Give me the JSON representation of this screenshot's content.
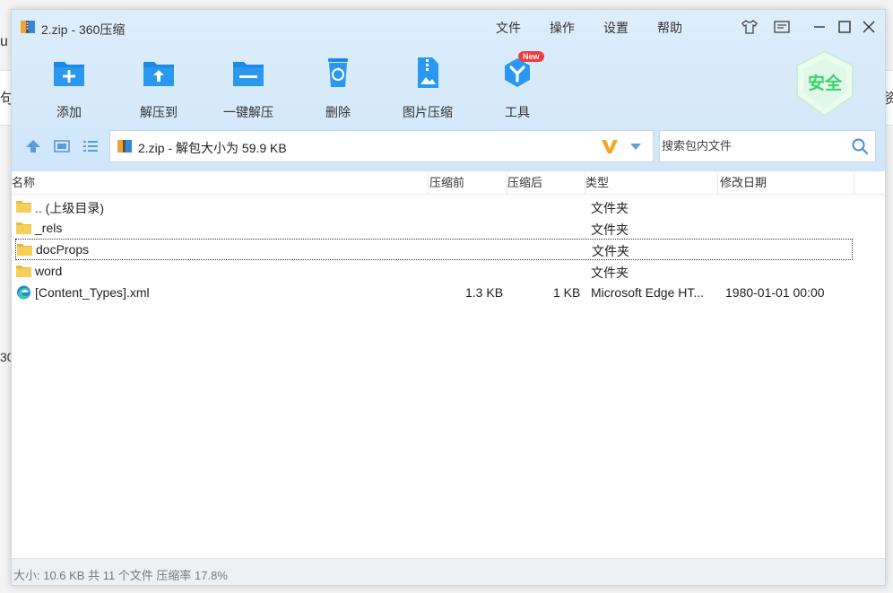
{
  "background": {
    "left_chars": [
      "u",
      "句",
      "30"
    ],
    "right_chars": [
      "资"
    ]
  },
  "window": {
    "title": "2.zip - 360压缩",
    "menu": [
      "文件",
      "操作",
      "设置",
      "帮助"
    ]
  },
  "toolbar": {
    "buttons": [
      {
        "label": "添加",
        "icon": "add-folder-icon"
      },
      {
        "label": "解压到",
        "icon": "extract-to-icon"
      },
      {
        "label": "一键解压",
        "icon": "one-click-extract-icon"
      },
      {
        "label": "删除",
        "icon": "recycle-delete-icon"
      },
      {
        "label": "图片压缩",
        "icon": "image-compress-icon"
      },
      {
        "label": "工具",
        "icon": "tools-icon",
        "badge": "New"
      }
    ],
    "security_label": "安全"
  },
  "pathbar": {
    "text": "2.zip - 解包大小为 59.9 KB"
  },
  "search": {
    "placeholder": "搜索包内文件"
  },
  "columns": [
    "名称",
    "压缩前",
    "压缩后",
    "类型",
    "修改日期"
  ],
  "files": [
    {
      "name": ".. (上级目录)",
      "before": "",
      "after": "",
      "type": "文件夹",
      "date": "",
      "icon": "folder-icon"
    },
    {
      "name": "_rels",
      "before": "",
      "after": "",
      "type": "文件夹",
      "date": "",
      "icon": "folder-icon"
    },
    {
      "name": "docProps",
      "before": "",
      "after": "",
      "type": "文件夹",
      "date": "",
      "icon": "folder-icon",
      "selected": true
    },
    {
      "name": "word",
      "before": "",
      "after": "",
      "type": "文件夹",
      "date": "",
      "icon": "folder-icon"
    },
    {
      "name": "[Content_Types].xml",
      "before": "1.3 KB",
      "after": "1 KB",
      "type": "Microsoft Edge HT...",
      "date": "1980-01-01 00:00",
      "icon": "edge-icon"
    }
  ],
  "status": {
    "text": "大小: 10.6 KB 共 11 个文件 压缩率 17.8%"
  },
  "colors": {
    "toolbar_bg": "#d6eafb",
    "accent_blue": "#1e88e5",
    "folder_yellow": "#f6c342",
    "badge_red": "#f43b3b",
    "shield_green": "#3ccf6e"
  }
}
